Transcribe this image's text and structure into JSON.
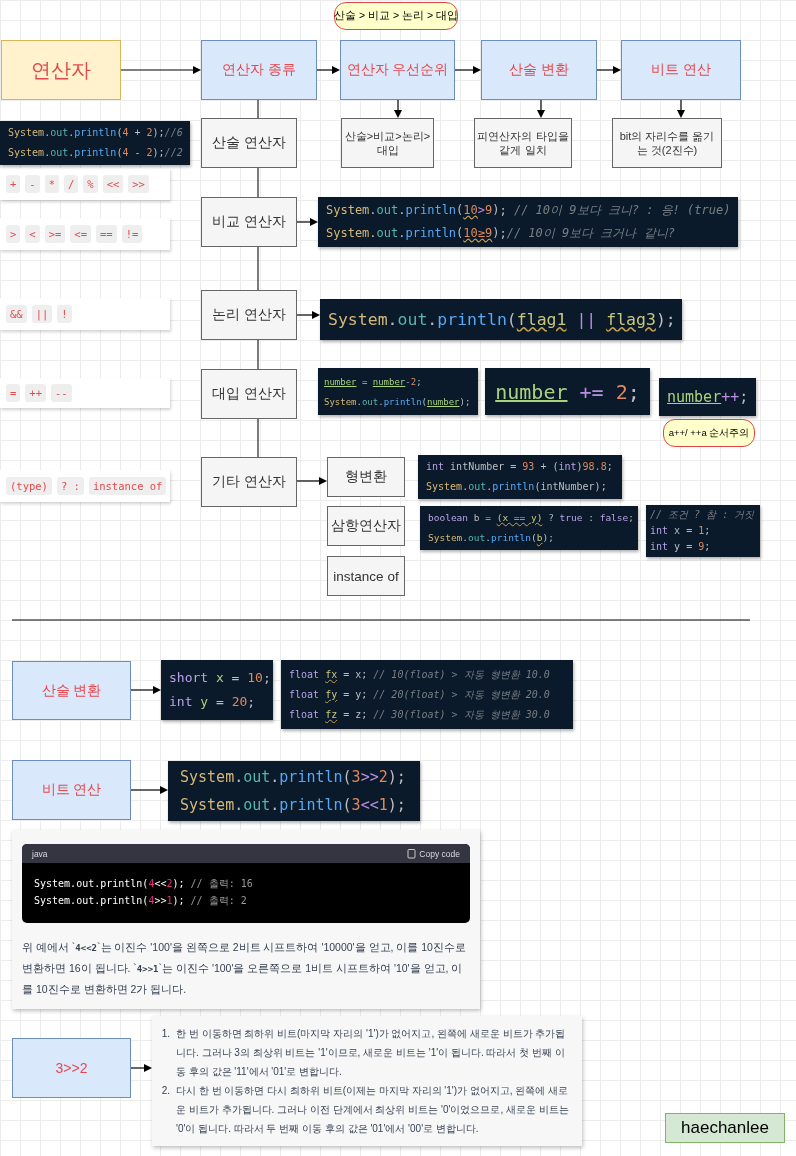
{
  "priority_note": "산술 > 비교 > 논리 > 대입",
  "flow": [
    {
      "text": "연산자",
      "kind": "root"
    },
    {
      "text": "연산자 종류",
      "kind": "step"
    },
    {
      "text": "연산자 우선순위",
      "kind": "step"
    },
    {
      "text": "산술 변환",
      "kind": "step"
    },
    {
      "text": "비트 연산",
      "kind": "step"
    }
  ],
  "flow_details": [
    "산술>비교>논리>대입",
    "피연산자의 타입을 같게 일치",
    "bit의 자리수를 옮기는 것(2진수)"
  ],
  "categories": [
    {
      "name": "산술 연산자",
      "operators": [
        "+",
        "-",
        "*",
        "/",
        "%",
        "<<",
        ">>"
      ],
      "snippets": [
        {
          "lines": [
            [
              {
                "kind": "class",
                "text": "System"
              },
              {
                "kind": "plain",
                "text": "."
              },
              {
                "kind": "member",
                "text": "out"
              },
              {
                "kind": "plain",
                "text": "."
              },
              {
                "kind": "call",
                "text": "println"
              },
              {
                "kind": "plain",
                "text": "("
              },
              {
                "kind": "number",
                "text": "4"
              },
              {
                "kind": "plain",
                "text": " + "
              },
              {
                "kind": "number",
                "text": "2"
              },
              {
                "kind": "plain",
                "text": ");"
              },
              {
                "kind": "comment",
                "text": "//6"
              }
            ],
            [
              {
                "kind": "class",
                "text": "System"
              },
              {
                "kind": "plain",
                "text": "."
              },
              {
                "kind": "member",
                "text": "out"
              },
              {
                "kind": "plain",
                "text": "."
              },
              {
                "kind": "call",
                "text": "println"
              },
              {
                "kind": "plain",
                "text": "("
              },
              {
                "kind": "number",
                "text": "4"
              },
              {
                "kind": "plain",
                "text": " - "
              },
              {
                "kind": "number",
                "text": "2"
              },
              {
                "kind": "plain",
                "text": ");"
              },
              {
                "kind": "comment",
                "text": "//2"
              }
            ]
          ]
        }
      ]
    },
    {
      "name": "비교 연산자",
      "operators": [
        ">",
        "<",
        ">=",
        "<=",
        "==",
        "!="
      ],
      "snippets": [
        {
          "lines": [
            [
              {
                "kind": "class",
                "text": "System"
              },
              {
                "kind": "plain",
                "text": "."
              },
              {
                "kind": "member",
                "text": "out"
              },
              {
                "kind": "plain",
                "text": "."
              },
              {
                "kind": "call",
                "text": "println"
              },
              {
                "kind": "plain",
                "text": "("
              },
              {
                "kind": "number_flagged",
                "text": "10"
              },
              {
                "kind": "operator",
                "text": ">"
              },
              {
                "kind": "number",
                "text": "9"
              },
              {
                "kind": "plain",
                "text": ");"
              },
              {
                "kind": "comment",
                "text": " // 10이 9보다 크니? : 응! (true)"
              }
            ],
            [
              {
                "kind": "class",
                "text": "System"
              },
              {
                "kind": "plain",
                "text": "."
              },
              {
                "kind": "member",
                "text": "out"
              },
              {
                "kind": "plain",
                "text": "."
              },
              {
                "kind": "call",
                "text": "println"
              },
              {
                "kind": "plain",
                "text": "("
              },
              {
                "kind": "number_flagged",
                "text": "10≥9"
              },
              {
                "kind": "plain",
                "text": ");"
              },
              {
                "kind": "comment",
                "text": "// 10이 9보다 크거나 같니?"
              }
            ]
          ]
        }
      ]
    },
    {
      "name": "논리 연산자",
      "operators": [
        "&&",
        "||",
        "!"
      ],
      "snippets": [
        {
          "lines": [
            [
              {
                "kind": "class",
                "text": "System"
              },
              {
                "kind": "plain",
                "text": "."
              },
              {
                "kind": "member",
                "text": "out"
              },
              {
                "kind": "plain",
                "text": "."
              },
              {
                "kind": "call",
                "text": "println"
              },
              {
                "kind": "plain",
                "text": "("
              },
              {
                "kind": "var_flagged",
                "text": "flag1"
              },
              {
                "kind": "operator",
                "text": " || "
              },
              {
                "kind": "var_flagged",
                "text": "flag3"
              },
              {
                "kind": "plain",
                "text": ");"
              }
            ]
          ]
        }
      ]
    },
    {
      "name": "대입 연산자",
      "operators": [
        "=",
        "++",
        "--"
      ],
      "snippets": [
        {
          "lines": [
            [
              {
                "kind": "var_underlined",
                "text": "number"
              },
              {
                "kind": "plain",
                "text": " = "
              },
              {
                "kind": "var_underlined",
                "text": "number"
              },
              {
                "kind": "operator",
                "text": "-"
              },
              {
                "kind": "number",
                "text": "2"
              },
              {
                "kind": "plain",
                "text": ";"
              }
            ],
            [
              {
                "kind": "class",
                "text": "System"
              },
              {
                "kind": "plain",
                "text": "."
              },
              {
                "kind": "member",
                "text": "out"
              },
              {
                "kind": "plain",
                "text": "."
              },
              {
                "kind": "call",
                "text": "println"
              },
              {
                "kind": "plain",
                "text": "("
              },
              {
                "kind": "var_underlined",
                "text": "number"
              },
              {
                "kind": "plain",
                "text": ");"
              }
            ]
          ]
        },
        {
          "lines": [
            [
              {
                "kind": "var_underlined",
                "text": "number"
              },
              {
                "kind": "operator",
                "text": " += "
              },
              {
                "kind": "number",
                "text": "2"
              },
              {
                "kind": "plain",
                "text": ";"
              }
            ]
          ]
        },
        {
          "lines": [
            [
              {
                "kind": "var_underlined",
                "text": "number"
              },
              {
                "kind": "operator",
                "text": "++"
              },
              {
                "kind": "plain",
                "text": ";"
              }
            ]
          ]
        }
      ],
      "note": "a++/ ++a 순서주의"
    },
    {
      "name": "기타 연산자",
      "operators": [
        "(type)",
        "? :",
        "instance of"
      ],
      "subtypes": [
        {
          "name": "형변환",
          "snippets": [
            {
              "lines": [
                [
                  {
                    "kind": "keyword",
                    "text": "int "
                  },
                  {
                    "kind": "plain",
                    "text": "intNumber = "
                  },
                  {
                    "kind": "number",
                    "text": "93"
                  },
                  {
                    "kind": "plain",
                    "text": " + ("
                  },
                  {
                    "kind": "keyword",
                    "text": "int"
                  },
                  {
                    "kind": "plain",
                    "text": ")"
                  },
                  {
                    "kind": "number",
                    "text": "98.8"
                  },
                  {
                    "kind": "plain",
                    "text": ";"
                  }
                ],
                [
                  {
                    "kind": "class",
                    "text": "System"
                  },
                  {
                    "kind": "plain",
                    "text": "."
                  },
                  {
                    "kind": "member",
                    "text": "out"
                  },
                  {
                    "kind": "plain",
                    "text": "."
                  },
                  {
                    "kind": "call",
                    "text": "println"
                  },
                  {
                    "kind": "plain",
                    "text": "(intNumber);"
                  }
                ]
              ]
            }
          ]
        },
        {
          "name": "삼항연산자",
          "snippets": [
            {
              "lines": [
                [
                  {
                    "kind": "keyword",
                    "text": "boolean "
                  },
                  {
                    "kind": "plain",
                    "text": "b = "
                  },
                  {
                    "kind": "var_flagged",
                    "text": "(x == y)"
                  },
                  {
                    "kind": "plain",
                    "text": " ? "
                  },
                  {
                    "kind": "keyword",
                    "text": "true"
                  },
                  {
                    "kind": "plain",
                    "text": " : "
                  },
                  {
                    "kind": "keyword",
                    "text": "false"
                  },
                  {
                    "kind": "plain",
                    "text": ";"
                  }
                ],
                [
                  {
                    "kind": "class",
                    "text": "System"
                  },
                  {
                    "kind": "plain",
                    "text": "."
                  },
                  {
                    "kind": "member",
                    "text": "out"
                  },
                  {
                    "kind": "plain",
                    "text": "."
                  },
                  {
                    "kind": "call",
                    "text": "println"
                  },
                  {
                    "kind": "plain",
                    "text": "("
                  },
                  {
                    "kind": "var_flagged",
                    "text": "b"
                  },
                  {
                    "kind": "plain",
                    "text": ");"
                  }
                ]
              ]
            },
            {
              "lines": [
                [
                  {
                    "kind": "comment",
                    "text": "// 조건 ? 참 : 거짓"
                  }
                ],
                [
                  {
                    "kind": "keyword",
                    "text": "int "
                  },
                  {
                    "kind": "plain",
                    "text": "x = "
                  },
                  {
                    "kind": "number",
                    "text": "1"
                  },
                  {
                    "kind": "plain",
                    "text": ";"
                  }
                ],
                [
                  {
                    "kind": "keyword",
                    "text": "int "
                  },
                  {
                    "kind": "plain",
                    "text": "y = "
                  },
                  {
                    "kind": "number",
                    "text": "9"
                  },
                  {
                    "kind": "plain",
                    "text": ";"
                  }
                ]
              ]
            }
          ]
        },
        {
          "name": "instance of"
        }
      ]
    }
  ],
  "sections": [
    {
      "title": "산술 변환",
      "snippets": [
        {
          "lines": [
            [
              {
                "kind": "keyword",
                "text": "short "
              },
              {
                "kind": "var",
                "text": "x"
              },
              {
                "kind": "plain",
                "text": " = "
              },
              {
                "kind": "number",
                "text": "10"
              },
              {
                "kind": "plain",
                "text": ";"
              }
            ],
            [
              {
                "kind": "keyword",
                "text": "int "
              },
              {
                "kind": "var",
                "text": "y"
              },
              {
                "kind": "plain",
                "text": " = "
              },
              {
                "kind": "number",
                "text": "20"
              },
              {
                "kind": "plain",
                "text": ";"
              }
            ]
          ]
        },
        {
          "lines": [
            [
              {
                "kind": "keyword",
                "text": "float "
              },
              {
                "kind": "var_flagged",
                "text": "fx"
              },
              {
                "kind": "plain",
                "text": " = x; "
              },
              {
                "kind": "comment",
                "text": "// 10(float) > 자동 형변환 10.0"
              }
            ],
            [
              {
                "kind": "keyword",
                "text": "float "
              },
              {
                "kind": "var_flagged",
                "text": "fy"
              },
              {
                "kind": "plain",
                "text": " = y; "
              },
              {
                "kind": "comment",
                "text": "// 20(float) > 자동 형변환 20.0"
              }
            ],
            [
              {
                "kind": "keyword",
                "text": "float "
              },
              {
                "kind": "var_flagged",
                "text": "fz"
              },
              {
                "kind": "plain",
                "text": " = z; "
              },
              {
                "kind": "comment",
                "text": "// 30(float) > 자동 형변환 30.0"
              }
            ]
          ]
        }
      ]
    },
    {
      "title": "비트 연산",
      "snippets": [
        {
          "lines": [
            [
              {
                "kind": "class",
                "text": "System"
              },
              {
                "kind": "plain",
                "text": "."
              },
              {
                "kind": "member",
                "text": "out"
              },
              {
                "kind": "plain",
                "text": "."
              },
              {
                "kind": "call",
                "text": "println"
              },
              {
                "kind": "plain",
                "text": "("
              },
              {
                "kind": "number",
                "text": "3"
              },
              {
                "kind": "operator",
                "text": ">>"
              },
              {
                "kind": "number",
                "text": "2"
              },
              {
                "kind": "plain",
                "text": ");"
              }
            ],
            [
              {
                "kind": "class",
                "text": "System"
              },
              {
                "kind": "plain",
                "text": "."
              },
              {
                "kind": "member",
                "text": "out"
              },
              {
                "kind": "plain",
                "text": "."
              },
              {
                "kind": "call",
                "text": "println"
              },
              {
                "kind": "plain",
                "text": "("
              },
              {
                "kind": "number",
                "text": "3"
              },
              {
                "kind": "operator",
                "text": "<<"
              },
              {
                "kind": "number",
                "text": "1"
              },
              {
                "kind": "plain",
                "text": ");"
              }
            ]
          ]
        }
      ],
      "chat_answer": {
        "language": "java",
        "copy_label": "Copy code",
        "lines": [
          [
            {
              "kind": "plain",
              "text": "System.out.println("
            },
            {
              "kind": "number",
              "text": "4"
            },
            {
              "kind": "plain",
              "text": "<<"
            },
            {
              "kind": "number",
              "text": "2"
            },
            {
              "kind": "plain",
              "text": ");"
            },
            {
              "kind": "comment",
              "text": " // 출력: 16"
            }
          ],
          [
            {
              "kind": "plain",
              "text": "System.out.println("
            },
            {
              "kind": "number",
              "text": "4"
            },
            {
              "kind": "plain",
              "text": ">>"
            },
            {
              "kind": "number",
              "text": "1"
            },
            {
              "kind": "plain",
              "text": ");"
            },
            {
              "kind": "comment",
              "text": " // 출력: 2"
            }
          ]
        ],
        "paragraph": "위 예에서 `**4<<2**`는 이진수 '100'을 왼쪽으로 2비트 시프트하여 '10000'을 얻고, 이를 10진수로 변환하면 16이 됩니다. `**4>>1**`는 이진수 '100'을 오른쪽으로 1비트 시프트하여 '10'을 얻고, 이를 10진수로 변환하면 2가 됩니다."
      }
    },
    {
      "title": "3>>2",
      "explanation": [
        {
          "marker": "1.",
          "text": "한 번 이동하면 최하위 비트(마지막 자리의 '1')가 없어지고, 왼쪽에 새로운 비트가 추가됩니다. 그러나 3의 최상위 비트는 '1'이므로, 새로운 비트는 '1'이 됩니다. 따라서 첫 번째 이동 후의 값은 '11'에서 '01'로 변합니다."
        },
        {
          "marker": "2.",
          "text": "다시 한 번 이동하면 다시 최하위 비트(이제는 마지막 자리의 '1')가 없어지고, 왼쪽에 새로운 비트가 추가됩니다. 그러나 이전 단계에서 최상위 비트는 '0'이었으므로, 새로운 비트는 '0'이 됩니다. 따라서 두 번째 이동 후의 값은 '01'에서 '00'로 변합니다."
        }
      ]
    }
  ],
  "signature": "haechanlee"
}
